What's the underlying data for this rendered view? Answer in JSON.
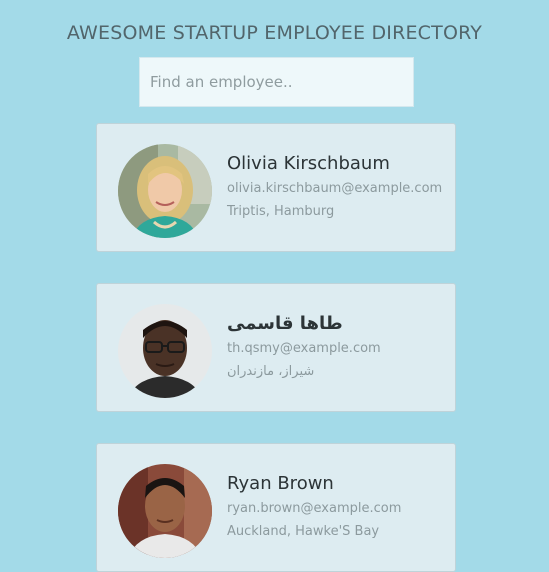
{
  "header": {
    "title": "AWESOME STARTUP EMPLOYEE DIRECTORY"
  },
  "search": {
    "placeholder": "Find an employee..",
    "value": ""
  },
  "colors": {
    "background": "#a3dae8",
    "card": "#ddecf1",
    "search_bg": "#eef8fa",
    "name_text": "#2c3437",
    "secondary_text": "#8c9a9e"
  },
  "employees": [
    {
      "name": "Olivia Kirschbaum",
      "email": "olivia.kirschbaum@example.com",
      "location": "Triptis, Hamburg",
      "avatar": "woman-blonde-avatar"
    },
    {
      "name": "طاها قاسمی",
      "email": "th.qsmy@example.com",
      "location": "شیراز، مازندران",
      "avatar": "man-glasses-avatar"
    },
    {
      "name": "Ryan Brown",
      "email": "ryan.brown@example.com",
      "location": "Auckland, Hawke'S Bay",
      "avatar": "young-man-avatar"
    }
  ]
}
